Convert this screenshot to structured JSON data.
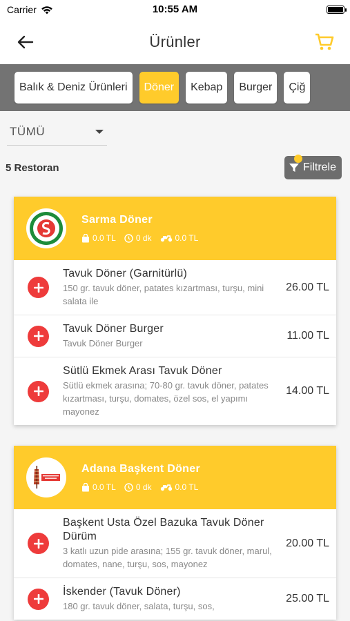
{
  "status": {
    "carrier": "Carrier",
    "time": "10:55 AM"
  },
  "header": {
    "title": "Ürünler"
  },
  "categories": [
    {
      "label": "Balık & Deniz Ürünleri",
      "active": false
    },
    {
      "label": "Döner",
      "active": true
    },
    {
      "label": "Kebap",
      "active": false
    },
    {
      "label": "Burger",
      "active": false
    },
    {
      "label": "Çiğ",
      "active": false
    }
  ],
  "filter": {
    "selected": "TÜMÜ",
    "button_label": "Filtrele"
  },
  "restaurant_count": "5 Restoran",
  "restaurants": [
    {
      "name": "Sarma Döner",
      "min_order": "0.0 TL",
      "delivery_time": "0 dk",
      "delivery_fee": "0.0 TL",
      "items": [
        {
          "name": "Tavuk Döner (Garnitürlü)",
          "desc": "150 gr. tavuk döner, patates kızartması, turşu, mini salata ile",
          "price": "26.00 TL"
        },
        {
          "name": "Tavuk Döner Burger",
          "desc": "Tavuk Döner Burger",
          "price": "11.00 TL"
        },
        {
          "name": "Sütlü Ekmek Arası Tavuk Döner",
          "desc": "Sütlü ekmek arasına; 70-80 gr. tavuk döner, patates kızartması, turşu, domates, özel sos, el yapımı mayonez",
          "price": "14.00 TL"
        }
      ]
    },
    {
      "name": "Adana Başkent Döner",
      "min_order": "0.0 TL",
      "delivery_time": "0 dk",
      "delivery_fee": "0.0 TL",
      "items": [
        {
          "name": "Başkent Usta Özel Bazuka Tavuk Döner Dürüm",
          "desc": "3 katlı uzun pide arasına; 155 gr. tavuk döner, marul, domates, nane, turşu, sos, mayonez",
          "price": "20.00 TL"
        },
        {
          "name": " İskender (Tavuk Döner)",
          "desc": "180 gr. tavuk döner, salata, turşu, sos,",
          "price": "25.00 TL"
        }
      ]
    }
  ],
  "colors": {
    "accent": "#ffcb2b",
    "add_button": "#ee3b3b",
    "category_bar": "#737373"
  },
  "icons": {
    "back": "arrow-left-icon",
    "cart": "cart-icon",
    "bag": "bag-icon",
    "clock": "clock-icon",
    "moped": "moped-icon",
    "filter": "funnel-icon",
    "add": "plus-icon"
  }
}
